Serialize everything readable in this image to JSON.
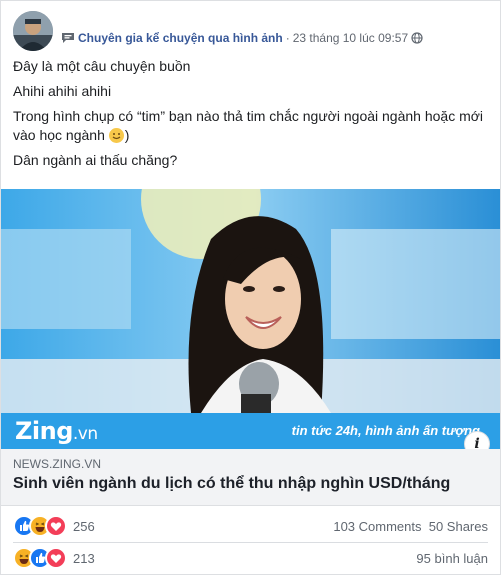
{
  "post": {
    "page_name": "Chuyên gia kể chuyện qua hình ảnh",
    "timestamp": "23 tháng 10 lúc 09:57",
    "separator": "·",
    "paragraphs": [
      "Đây là một câu chuyện buồn",
      "Ahihi ahihi ahihi",
      "Trong hình chụp có “tim” bạn nào thả tim chắc người ngoài ngành hoặc mới vào học ngành",
      "Dân ngành ai thấu chăng?"
    ],
    "paragraph3_suffix": ")"
  },
  "image_brand": {
    "logo_main": "Zing",
    "logo_suffix": ".vn",
    "slogan": "tin tức 24h, hình ảnh ấn tượng",
    "info_icon": "i"
  },
  "link": {
    "domain": "NEWS.ZING.VN",
    "title": "Sinh viên ngành du lịch có thể thu nhập nghìn USD/tháng"
  },
  "reactions_1": {
    "icons": [
      "like-icon",
      "haha-icon",
      "love-icon"
    ],
    "count": "256",
    "comments": "103 Comments",
    "shares": "50 Shares"
  },
  "reactions_2": {
    "icons": [
      "haha-icon",
      "like-icon",
      "love-icon"
    ],
    "count": "213",
    "comments": "95 bình luận"
  },
  "colors": {
    "link_blue": "#385898",
    "like_blue": "#1877f2",
    "love_red": "#f33e58",
    "haha_yellow": "#f7b125",
    "brand_blue": "#2c9fe6"
  }
}
